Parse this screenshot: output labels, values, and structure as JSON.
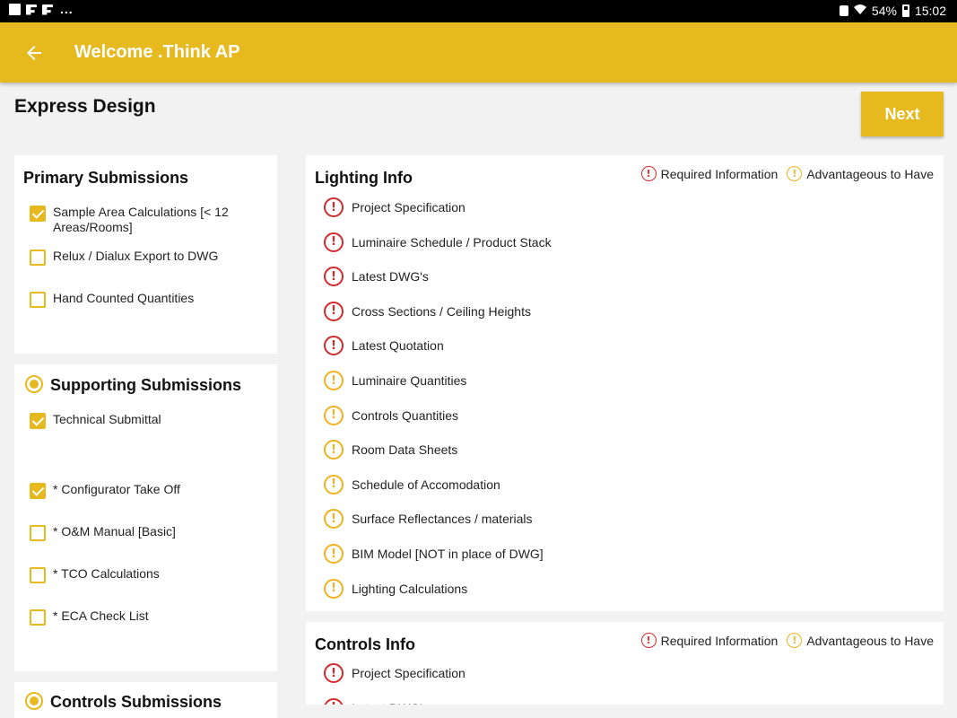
{
  "status_bar": {
    "battery": "54%",
    "time": "15:02",
    "overflow": "..."
  },
  "app_bar": {
    "title": "Welcome .Think AP"
  },
  "page": {
    "title": "Express Design",
    "next_label": "Next"
  },
  "legend": {
    "required": "Required Information",
    "advantageous": "Advantageous to Have"
  },
  "primary": {
    "title": "Primary Submissions",
    "items": [
      {
        "label": "Sample Area Calculations  [< 12 Areas/Rooms]",
        "checked": true
      },
      {
        "label": "Relux / Dialux Export to DWG",
        "checked": false
      },
      {
        "label": "Hand Counted Quantities",
        "checked": false
      }
    ]
  },
  "supporting": {
    "title": "Supporting Submissions",
    "items": [
      {
        "label": "Technical Submittal",
        "checked": true
      },
      {
        "label": "* Configurator Take Off",
        "checked": true
      },
      {
        "label": "* O&M Manual [Basic]",
        "checked": false
      },
      {
        "label": "* TCO Calculations",
        "checked": false
      },
      {
        "label": "* ECA Check List",
        "checked": false
      }
    ]
  },
  "controls_submissions": {
    "title": "Controls Submissions"
  },
  "lighting_info": {
    "title": "Lighting Info",
    "items": [
      {
        "label": "Project Specification",
        "level": "required"
      },
      {
        "label": "Luminaire Schedule / Product Stack",
        "level": "required"
      },
      {
        "label": "Latest DWG's",
        "level": "required"
      },
      {
        "label": "Cross Sections / Ceiling Heights",
        "level": "required"
      },
      {
        "label": "Latest Quotation",
        "level": "required"
      },
      {
        "label": "Luminaire Quantities",
        "level": "advantageous"
      },
      {
        "label": "Controls Quantities",
        "level": "advantageous"
      },
      {
        "label": "Room Data Sheets",
        "level": "advantageous"
      },
      {
        "label": "Schedule of Accomodation",
        "level": "advantageous"
      },
      {
        "label": "Surface Reflectances / materials",
        "level": "advantageous"
      },
      {
        "label": "BIM Model [NOT in place of DWG]",
        "level": "advantageous"
      },
      {
        "label": "Lighting Calculations",
        "level": "advantageous"
      }
    ]
  },
  "controls_info": {
    "title": "Controls Info",
    "items": [
      {
        "label": "Project Specification",
        "level": "required"
      },
      {
        "label": "Latest DWG's",
        "level": "required"
      }
    ]
  },
  "colors": {
    "accent": "#e6b91e",
    "required": "#d02a2a",
    "advantageous": "#f0b21f"
  },
  "icon_glyph": "!"
}
